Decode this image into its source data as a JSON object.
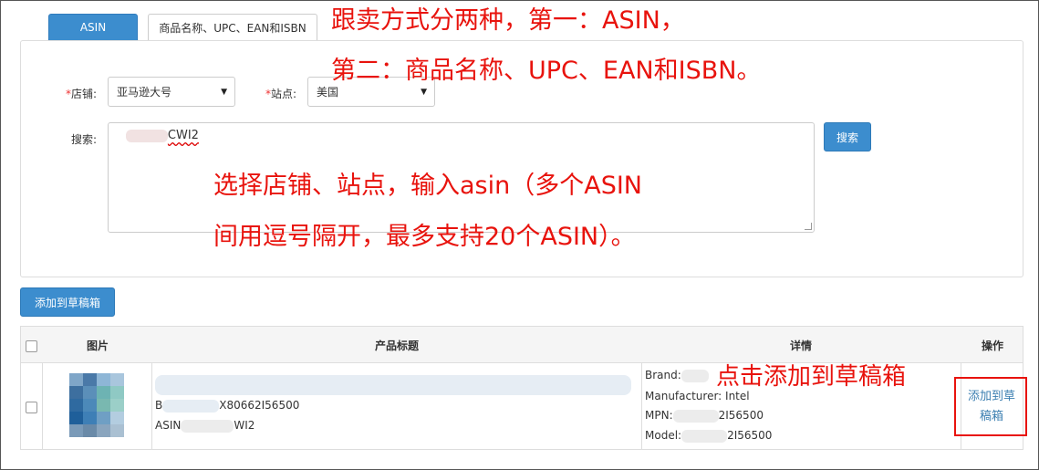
{
  "tabs": {
    "asin": "ASIN",
    "other": "商品名称、UPC、EAN和ISBN"
  },
  "form": {
    "store_label": "店铺:",
    "store_value": "亚马逊大号",
    "site_label": "站点:",
    "site_value": "美国",
    "search_label": "搜索:",
    "search_value_prefix": "B",
    "search_value": "CWI2",
    "search_button": "搜索",
    "required_mark": "*"
  },
  "add_draft_button": "添加到草稿箱",
  "annotations": {
    "line1": "跟卖方式分两种，第一：ASIN，",
    "line2": "第二：商品名称、UPC、EAN和ISBN。",
    "line3": "选择店铺、站点，输入asin（多个ASIN",
    "line4": "间用逗号隔开，最多支持20个ASIN）。",
    "line5": "点击添加到草稿箱"
  },
  "table": {
    "headers": {
      "image": "图片",
      "title": "产品标题",
      "details": "详情",
      "actions": "操作"
    },
    "row": {
      "link_prefix": "B",
      "link_suffix": "X80662I56500",
      "asin_label": "ASIN",
      "asin_suffix": "WI2",
      "brand": "Brand:",
      "manufacturer": "Manufacturer: Intel",
      "mpn_label": "MPN:",
      "mpn_suffix": "2I56500",
      "model_label": "Model:",
      "model_suffix": "2I56500",
      "action": "添加到草稿箱"
    }
  },
  "colors": {
    "primary": "#3c8dce",
    "annotation": "#e8130d",
    "link": "#3c7fb1"
  }
}
